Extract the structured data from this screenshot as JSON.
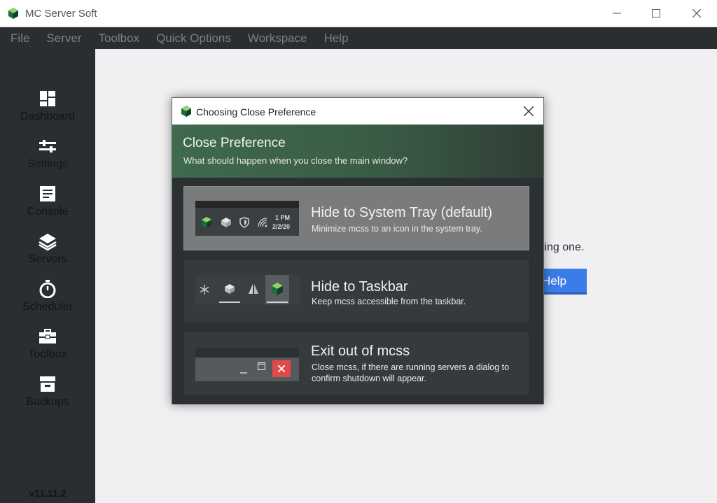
{
  "window": {
    "title": "MC Server Soft",
    "min_icon": "minimize-icon",
    "max_icon": "maximize-icon",
    "close_icon": "close-icon"
  },
  "menu": [
    "File",
    "Server",
    "Toolbox",
    "Quick Options",
    "Workspace",
    "Help"
  ],
  "sidebar": {
    "items": [
      {
        "label": "Dashboard",
        "icon": "dashboard-icon"
      },
      {
        "label": "Settings",
        "icon": "sliders-icon"
      },
      {
        "label": "Console",
        "icon": "console-icon"
      },
      {
        "label": "Servers",
        "icon": "layers-icon"
      },
      {
        "label": "Scheduler",
        "icon": "stopwatch-icon"
      },
      {
        "label": "Toolbox",
        "icon": "toolbox-icon"
      },
      {
        "label": "Backups",
        "icon": "archive-icon"
      }
    ],
    "version": "v11.11.2"
  },
  "background": {
    "partial_text": "sting one.",
    "partial_button": "Help"
  },
  "dialog": {
    "title": "Choosing Close Preference",
    "header_title": "Close Preference",
    "header_subtitle": "What should happen when you close the main window?",
    "options": [
      {
        "title": "Hide to System Tray (default)",
        "desc": "Minimize mcss to an icon in the system tray.",
        "selected": true,
        "preview": {
          "time": "1 PM",
          "date": "2/2/20"
        }
      },
      {
        "title": "Hide to Taskbar",
        "desc": "Keep mcss accessible from the taskbar.",
        "selected": false
      },
      {
        "title": "Exit out of mcss",
        "desc": "Close mcss, if there are running servers a dialog to confirm shutdown will appear.",
        "selected": false
      }
    ]
  },
  "colors": {
    "accent_green": "#3f6a4e",
    "sidebar_bg": "#2a2e31",
    "button_blue": "#3b7de8",
    "close_red": "#e04a4a"
  }
}
